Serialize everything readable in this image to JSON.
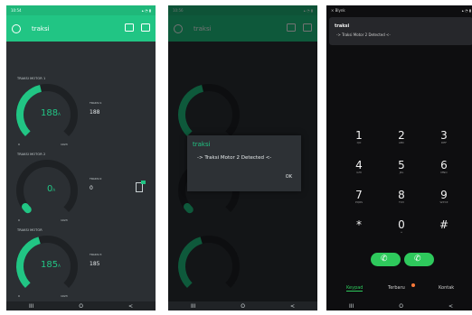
{
  "phone1": {
    "status_time": "10:54",
    "app_title": "traksi",
    "widgets": [
      {
        "label": "TRAKSI MOTOR 1",
        "gauge_value": "188",
        "unit": "A",
        "fraction": 0.45,
        "gauge_min": "0",
        "gauge_max": "1023",
        "side_label": "TRAKSI 1",
        "side_value": "188"
      },
      {
        "label": "TRAKSI MOTOR 2",
        "gauge_value": "0",
        "unit": "A",
        "fraction": 0.0,
        "gauge_min": "0",
        "gauge_max": "1023",
        "side_label": "TRAKSI 2",
        "side_value": "0"
      },
      {
        "label": "TRAKSI MOTOR",
        "gauge_value": "185",
        "unit": "A",
        "fraction": 0.44,
        "gauge_min": "0",
        "gauge_max": "1023",
        "side_label": "TRAKSI 3",
        "side_value": "185"
      }
    ],
    "nav": [
      "III",
      "O",
      "<"
    ]
  },
  "phone2": {
    "status_time": "10:56",
    "app_title": "traksi",
    "dialog_title": "traksi",
    "dialog_message": "-> Traksi Motor 2 Detected <-",
    "dialog_ok": "OK",
    "nav": [
      "III",
      "O",
      "<"
    ]
  },
  "phone3": {
    "status_app": "Blynk",
    "notification_title": "traksi",
    "notification_message": "-> Traksi Motor 2 Detected <-",
    "keys": [
      {
        "digit": "1",
        "sub": "QO"
      },
      {
        "digit": "2",
        "sub": "ABC"
      },
      {
        "digit": "3",
        "sub": "DEF"
      },
      {
        "digit": "4",
        "sub": "GHI"
      },
      {
        "digit": "5",
        "sub": "JKL"
      },
      {
        "digit": "6",
        "sub": "MNO"
      },
      {
        "digit": "7",
        "sub": "PQRS"
      },
      {
        "digit": "8",
        "sub": "TUV"
      },
      {
        "digit": "9",
        "sub": "WXYZ"
      },
      {
        "digit": "*",
        "sub": ""
      },
      {
        "digit": "0",
        "sub": "+"
      },
      {
        "digit": "#",
        "sub": ""
      }
    ],
    "tabs": [
      "Keypad",
      "Terbaru",
      "Kontak"
    ],
    "nav": [
      "III",
      "O",
      "<"
    ]
  },
  "colors": {
    "accent": "#21c584",
    "panel": "#2b2f33",
    "track": "#1e2124"
  }
}
